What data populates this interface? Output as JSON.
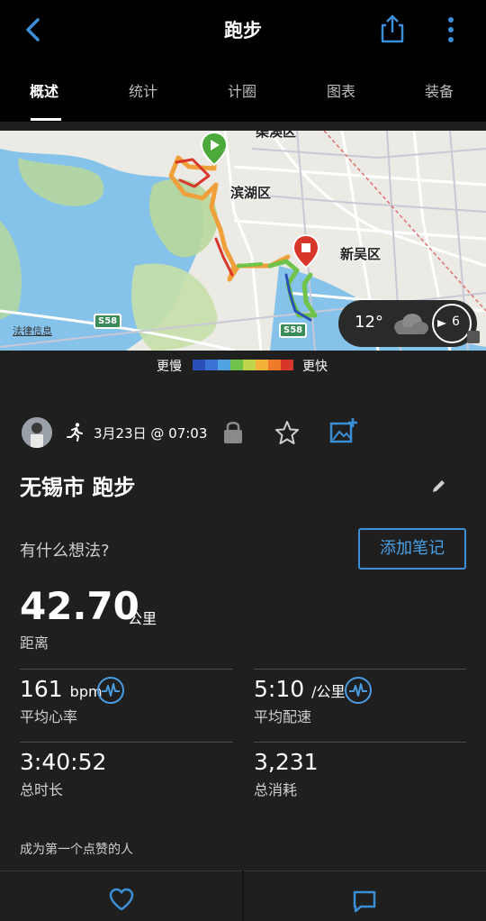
{
  "header": {
    "title": "跑步"
  },
  "tabs": [
    {
      "label": "概述",
      "active": true
    },
    {
      "label": "统计",
      "active": false
    },
    {
      "label": "计圈",
      "active": false
    },
    {
      "label": "图表",
      "active": false
    },
    {
      "label": "装备",
      "active": false
    }
  ],
  "map": {
    "labels": {
      "top": "渠澳区",
      "district1": "滨湖区",
      "district2": "新吴区"
    },
    "legal": "法律信息",
    "road_badges": [
      "S58",
      "S58"
    ],
    "weather": {
      "temperature": "12°",
      "wind": "6"
    }
  },
  "speed_legend": {
    "slow": "更慢",
    "fast": "更快",
    "colors": [
      "#2a4fb6",
      "#3b72d6",
      "#4fa3e0",
      "#6fc24a",
      "#bfd44a",
      "#f2b23a",
      "#f07a2a",
      "#d8362a"
    ]
  },
  "activity": {
    "date": "3月23日 @ 07:03",
    "name": "无锡市 跑步",
    "thoughts_prompt": "有什么想法?",
    "add_note": "添加笔记",
    "distance": "42.70",
    "distance_unit": "公里",
    "distance_label": "距离"
  },
  "stats": {
    "heart_rate": {
      "value": "161",
      "unit": "bpm",
      "label": "平均心率"
    },
    "pace": {
      "value": "5:10",
      "unit": "/公里",
      "label": "平均配速"
    },
    "duration": {
      "value": "3:40:52",
      "label": "总时长"
    },
    "calories": {
      "value": "3,231",
      "label": "总消耗"
    }
  },
  "social": {
    "kudos_prompt": "成为第一个点赞的人"
  },
  "colors": {
    "accent": "#3b8fd6",
    "background": "#1f1f1f",
    "header": "#000000"
  }
}
